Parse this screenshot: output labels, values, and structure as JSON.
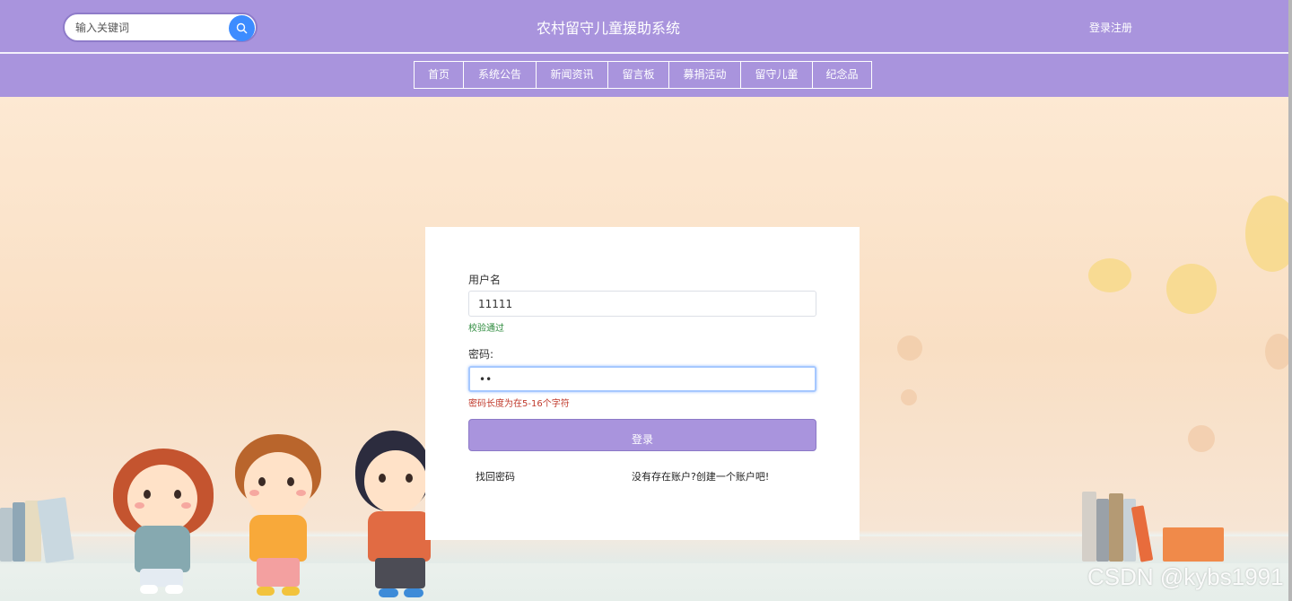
{
  "header": {
    "search_placeholder": "输入关键词",
    "site_title": "农村留守儿童援助系统",
    "auth_link": "登录注册"
  },
  "nav": {
    "items": [
      {
        "label": "首页"
      },
      {
        "label": "系统公告"
      },
      {
        "label": "新闻资讯"
      },
      {
        "label": "留言板"
      },
      {
        "label": "募捐活动"
      },
      {
        "label": "留守儿童"
      },
      {
        "label": "纪念品"
      }
    ]
  },
  "login": {
    "username_label": "用户名",
    "username_value": "11111",
    "username_hint": "校验通过",
    "password_label": "密码:",
    "password_value": "••",
    "password_hint": "密码长度为在5-16个字符",
    "submit_label": "登录",
    "forgot_link": "找回密码",
    "register_link": "没有存在账户?创建一个账户吧!"
  },
  "colors": {
    "brand": "#a994dd",
    "search_button": "#3d8cff",
    "success_hint": "#2e8b3e",
    "error_hint": "#c0392b"
  },
  "watermark": "CSDN @kybs1991"
}
